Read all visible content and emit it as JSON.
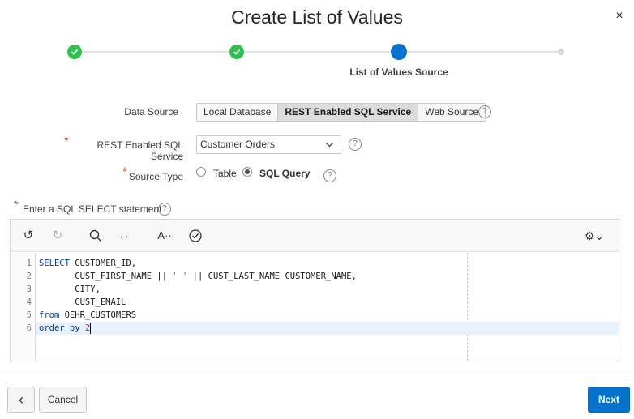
{
  "dialog": {
    "title": "Create List of Values",
    "close_glyph": "×"
  },
  "wizard": {
    "steps": [
      {
        "state": "done"
      },
      {
        "state": "done"
      },
      {
        "state": "current",
        "label": "List of Values Source"
      },
      {
        "state": "pending"
      }
    ]
  },
  "form": {
    "data_source": {
      "label": "Data Source",
      "options": [
        "Local Database",
        "REST Enabled SQL Service",
        "Web Source"
      ],
      "selected": "REST Enabled SQL Service"
    },
    "rest_service": {
      "label": "REST Enabled SQL Service",
      "value": "Customer Orders",
      "required": true
    },
    "source_type": {
      "label": "Source Type",
      "options": [
        "Table",
        "SQL Query"
      ],
      "selected": "SQL Query",
      "required": true
    },
    "sql_statement": {
      "label": "Enter a SQL SELECT statement",
      "required": true
    },
    "help_glyph": "?",
    "required_glyph": "*"
  },
  "editor": {
    "toolbar": {
      "undo_icon": "↺",
      "redo_icon": "↻",
      "search_icon": "⌕",
      "replace_icon": "↔",
      "font_icon": "A··",
      "validate_icon": "✓",
      "settings_icon": "⚙⌄"
    },
    "line_numbers": [
      "1",
      "2",
      "3",
      "4",
      "5",
      "6"
    ],
    "code": {
      "l1": [
        "SELECT",
        " CUSTOMER_ID,"
      ],
      "l2": [
        "       CUST_FIRST_NAME || ",
        "' '",
        " || CUST_LAST_NAME CUSTOMER_NAME,"
      ],
      "l3": "       CITY,",
      "l4": "       CUST_EMAIL",
      "l5": [
        "from",
        " OEHR_CUSTOMERS"
      ],
      "l6": [
        "order by",
        " ",
        "2"
      ]
    }
  },
  "footer": {
    "back_glyph": "‹",
    "cancel_label": "Cancel",
    "next_label": "Next"
  },
  "colors": {
    "primary": "#0572ce",
    "success": "#2ebf4f",
    "required": "#c74634"
  }
}
